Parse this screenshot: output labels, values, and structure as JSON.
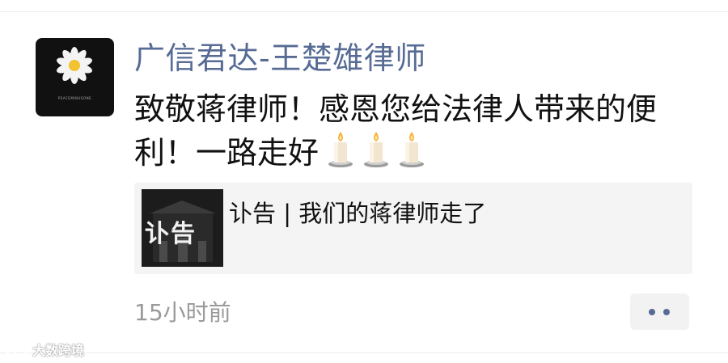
{
  "post": {
    "author": "广信君达-王楚雄律师",
    "text_line1": "致敬蒋律师！感恩您给法律人带来的便",
    "text_line2": "利！一路走好",
    "emoji": [
      "candle-emoji",
      "candle-emoji",
      "candle-emoji"
    ],
    "timestamp": "15小时前"
  },
  "avatar": {
    "icon": "daisy-icon",
    "caption": "PEACEMINUSONE"
  },
  "link_card": {
    "thumbnail_title": "讣告",
    "title": "讣告 | 我们的蒋律师走了"
  },
  "colors": {
    "name_blue": "#576b95",
    "card_bg": "#f4f4f4",
    "timestamp_gray": "#9a9a9a"
  },
  "watermark": {
    "text": "大数跨境"
  }
}
